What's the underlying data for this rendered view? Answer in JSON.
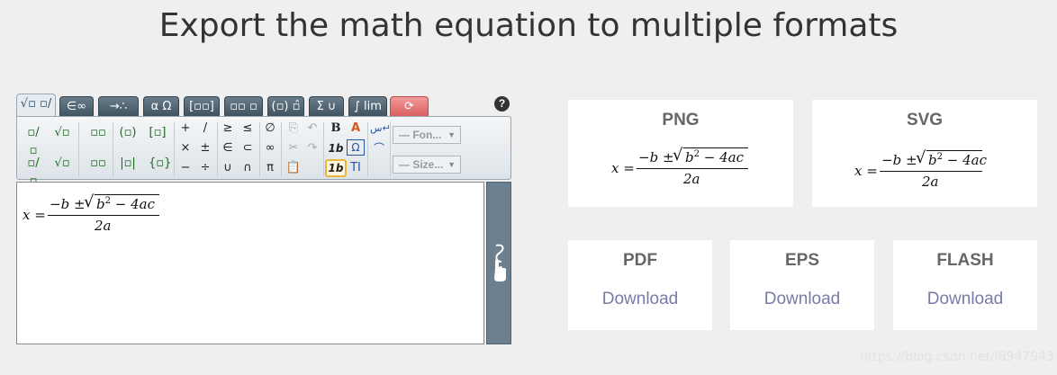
{
  "page": {
    "title": "Export the math equation to multiple formats"
  },
  "editor": {
    "tabs": [
      "√▫ ▫/▫",
      "∈∞",
      "→∴",
      "α Ω",
      "[▫▫]",
      "▫▫ ▫",
      "(▫) ▫̂",
      "Σ ∪",
      "∫ lim",
      "⟳"
    ],
    "help": "?",
    "toolbar": {
      "row1": [
        "▫/▫",
        "√▫",
        "▫▫",
        "(▫)",
        "[▫]",
        "+",
        "/",
        "≥",
        "≤",
        "∅",
        "B",
        "A"
      ],
      "row2": [
        "×",
        "±",
        "∈",
        "⊂",
        "∞",
        "1b",
        "Ω"
      ],
      "row3": [
        "▫/▫",
        "√▫",
        "▫▫",
        "|▫|",
        "{▫}",
        "−",
        "÷",
        "∪",
        "∩",
        "π",
        "1b",
        "TI"
      ],
      "font_select": "— Fon...",
      "size_select": "— Size..."
    }
  },
  "equation": {
    "lhs": "x =",
    "numerator_pre": "−b ± ",
    "radicand": "b",
    "radicand_exp": "2",
    "radicand_post": " − 4ac",
    "denominator": "2a"
  },
  "exports": {
    "png": {
      "label": "PNG"
    },
    "svg": {
      "label": "SVG"
    },
    "pdf": {
      "label": "PDF",
      "link": "Download"
    },
    "eps": {
      "label": "EPS",
      "link": "Download"
    },
    "flash": {
      "label": "FLASH",
      "link": "Download"
    }
  },
  "watermark": "https://blog.csdn.net/l8947943"
}
